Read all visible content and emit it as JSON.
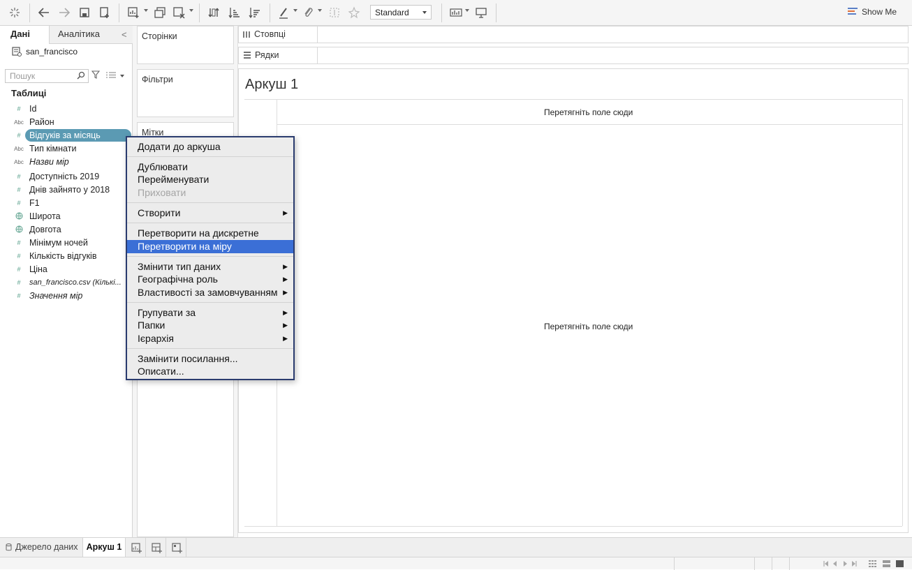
{
  "toolbar": {
    "fit_select": "Standard",
    "show_me": "Show Me",
    "icons": [
      "tableau-logo-icon",
      "undo-icon",
      "redo-icon",
      "save-icon",
      "add-datasource-icon",
      "new-worksheet-icon",
      "duplicate-sheet-icon",
      "clear-sheet-icon",
      "swap-icon",
      "sort-ascending-icon",
      "sort-descending-icon",
      "highlight-icon",
      "annotate-icon",
      "fix-axes-icon",
      "pin-icon",
      "show-labels-icon",
      "presentation-icon"
    ]
  },
  "datapane": {
    "tab_data": "Дані",
    "tab_analytics": "Аналітика",
    "datasource": "san_francisco",
    "search_placeholder": "Пошук",
    "tables_heading": "Таблиці",
    "fields": [
      {
        "type": "#",
        "label": "Id"
      },
      {
        "type": "Abc",
        "label": "Район"
      },
      {
        "type": "#",
        "label": "Відгуків за місяць"
      },
      {
        "type": "Abc",
        "label": "Тип кімнати"
      },
      {
        "type": "Abc",
        "label": "Назви мір"
      },
      {
        "type": "#",
        "label": "Доступність 2019"
      },
      {
        "type": "#",
        "label": "Днів зайнято у 2018"
      },
      {
        "type": "#",
        "label": "F1"
      },
      {
        "type": "globe",
        "label": "Широта"
      },
      {
        "type": "globe",
        "label": "Довгота"
      },
      {
        "type": "#",
        "label": "Мінімум ночей"
      },
      {
        "type": "#",
        "label": "Кількість відгуків"
      },
      {
        "type": "#",
        "label": "Ціна"
      },
      {
        "type": "#",
        "label": "san_francisco.csv (Кількі..."
      },
      {
        "type": "#",
        "label": "Значення мір"
      }
    ]
  },
  "cards": {
    "pages": "Сторінки",
    "filters": "Фільтри",
    "marks": "Мітки"
  },
  "shelves": {
    "columns": "Стовпці",
    "rows": "Рядки"
  },
  "view": {
    "title": "Аркуш 1",
    "drop_top": "Перетягніть поле сюди",
    "drop_center": "Перетягніть поле сюди"
  },
  "menu": {
    "add_to_sheet": "Додати до аркуша",
    "duplicate": "Дублювати",
    "rename": "Перейменувати",
    "hide": "Приховати",
    "create": "Створити",
    "to_discrete": "Перетворити на дискретне",
    "to_measure": "Перетворити на міру",
    "change_type": "Змінити тип даних",
    "geo_role": "Географічна роль",
    "default_props": "Властивості за замовчуванням",
    "group_by": "Групувати за",
    "folders": "Папки",
    "hierarchy": "Ієрархія",
    "replace_refs": "Замінити посилання...",
    "describe": "Описати..."
  },
  "bottom": {
    "datasource_tab": "Джерело даних",
    "sheet_tab": "Аркуш 1"
  }
}
